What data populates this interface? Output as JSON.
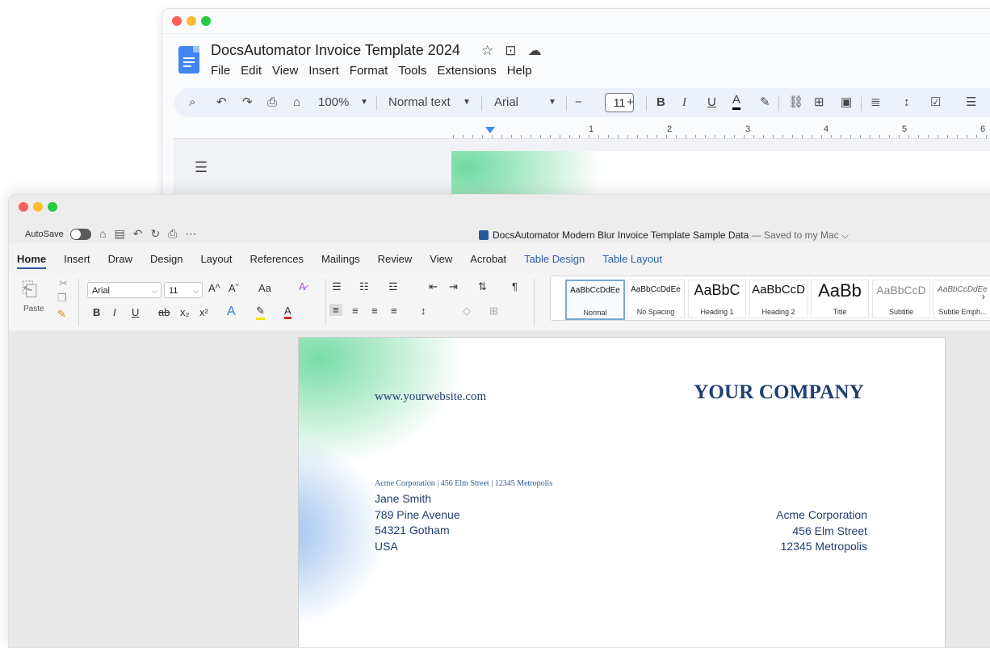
{
  "gdocs": {
    "title": "DocsAutomator Invoice Template 2024",
    "title_icons": [
      "star-icon",
      "folder-move-icon",
      "cloud-status-icon"
    ],
    "menu": [
      "File",
      "Edit",
      "View",
      "Insert",
      "Format",
      "Tools",
      "Extensions",
      "Help"
    ],
    "toolbar": {
      "zoom": "100%",
      "style": "Normal text",
      "font": "Arial",
      "font_size": "11",
      "minus": "−",
      "plus": "+",
      "bold": "B",
      "italic": "I",
      "underline": "U",
      "text_color": "A"
    },
    "ruler_numbers": [
      "1",
      "2",
      "3",
      "4",
      "5",
      "6"
    ]
  },
  "word": {
    "autosave_label": "AutoSave",
    "doc_title": "DocsAutomator Modern Blur Invoice Template Sample Data",
    "doc_status": " — Saved to my Mac ⌵",
    "tabs": [
      "Home",
      "Insert",
      "Draw",
      "Design",
      "Layout",
      "References",
      "Mailings",
      "Review",
      "View",
      "Acrobat",
      "Table Design",
      "Table Layout"
    ],
    "ribbon": {
      "paste_label": "Paste",
      "font": "Arial",
      "font_size": "11",
      "grow_font": "A^",
      "shrink_font": "Aˇ",
      "change_case": "Aa",
      "bold": "B",
      "italic": "I",
      "underline": "U",
      "strike": "ab",
      "subscript": "x₂",
      "superscript": "x²",
      "pilcrow": "¶"
    },
    "styles": [
      {
        "sample": "AaBbCcDdEe",
        "label": "Normal"
      },
      {
        "sample": "AaBbCcDdEe",
        "label": "No Spacing"
      },
      {
        "sample": "AaBbC",
        "label": "Heading 1"
      },
      {
        "sample": "AaBbCcD",
        "label": "Heading 2"
      },
      {
        "sample": "AaBb",
        "label": "Title"
      },
      {
        "sample": "AaBbCcD",
        "label": "Subtitle"
      },
      {
        "sample": "AaBbCcDdEe",
        "label": "Subtle Emph..."
      }
    ],
    "document": {
      "website": "www.yourwebsite.com",
      "company": "YOUR COMPANY",
      "sender_line": "Acme Corporation | 456 Elm Street | 12345 Metropolis",
      "recipient": [
        "Jane Smith",
        "789 Pine Avenue",
        "54321 Gotham",
        "USA"
      ],
      "sender": [
        "Acme Corporation",
        "456 Elm Street",
        "12345 Metropolis"
      ]
    }
  },
  "colors": {
    "accent_blue": "#1e3f73",
    "word_brand": "#2b579a",
    "gdocs_blue": "#4285f4",
    "blur_green": "#60d696",
    "blur_blue": "#78aae6"
  }
}
